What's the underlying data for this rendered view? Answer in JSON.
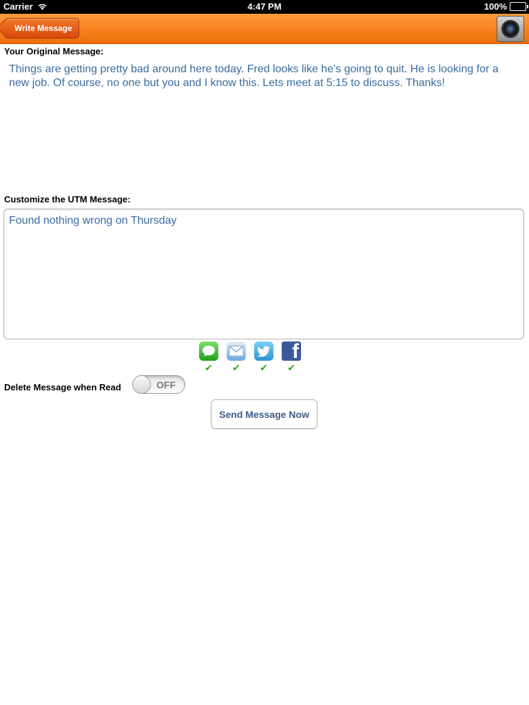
{
  "status_bar": {
    "carrier": "Carrier",
    "time": "4:47 PM",
    "battery": "100%"
  },
  "nav_bar": {
    "back_label": "Write Message",
    "camera_icon": "camera-icon",
    "accent_color": "#f7811d"
  },
  "original": {
    "label": "Your Original Message:",
    "text": "Things are getting pretty bad around here today.  Fred looks like he's going to quit. He is looking for a new job.  Of course, no one but you and I know this. Lets meet at 5:15 to discuss. Thanks!"
  },
  "utm": {
    "label": "Customize the UTM Message:",
    "value": "Found nothing wrong on Thursday"
  },
  "share": [
    {
      "name": "messages",
      "icon": "messages-icon",
      "checked": true
    },
    {
      "name": "mail",
      "icon": "mail-icon",
      "checked": true
    },
    {
      "name": "twitter",
      "icon": "twitter-icon",
      "checked": true
    },
    {
      "name": "facebook",
      "icon": "facebook-icon",
      "checked": true
    }
  ],
  "check_mark": "✔",
  "delete_option": {
    "label": "Delete Message when Read",
    "toggle_state": "OFF"
  },
  "send_button": {
    "label": "Send Message Now"
  },
  "text_color": "#3a6ba0"
}
